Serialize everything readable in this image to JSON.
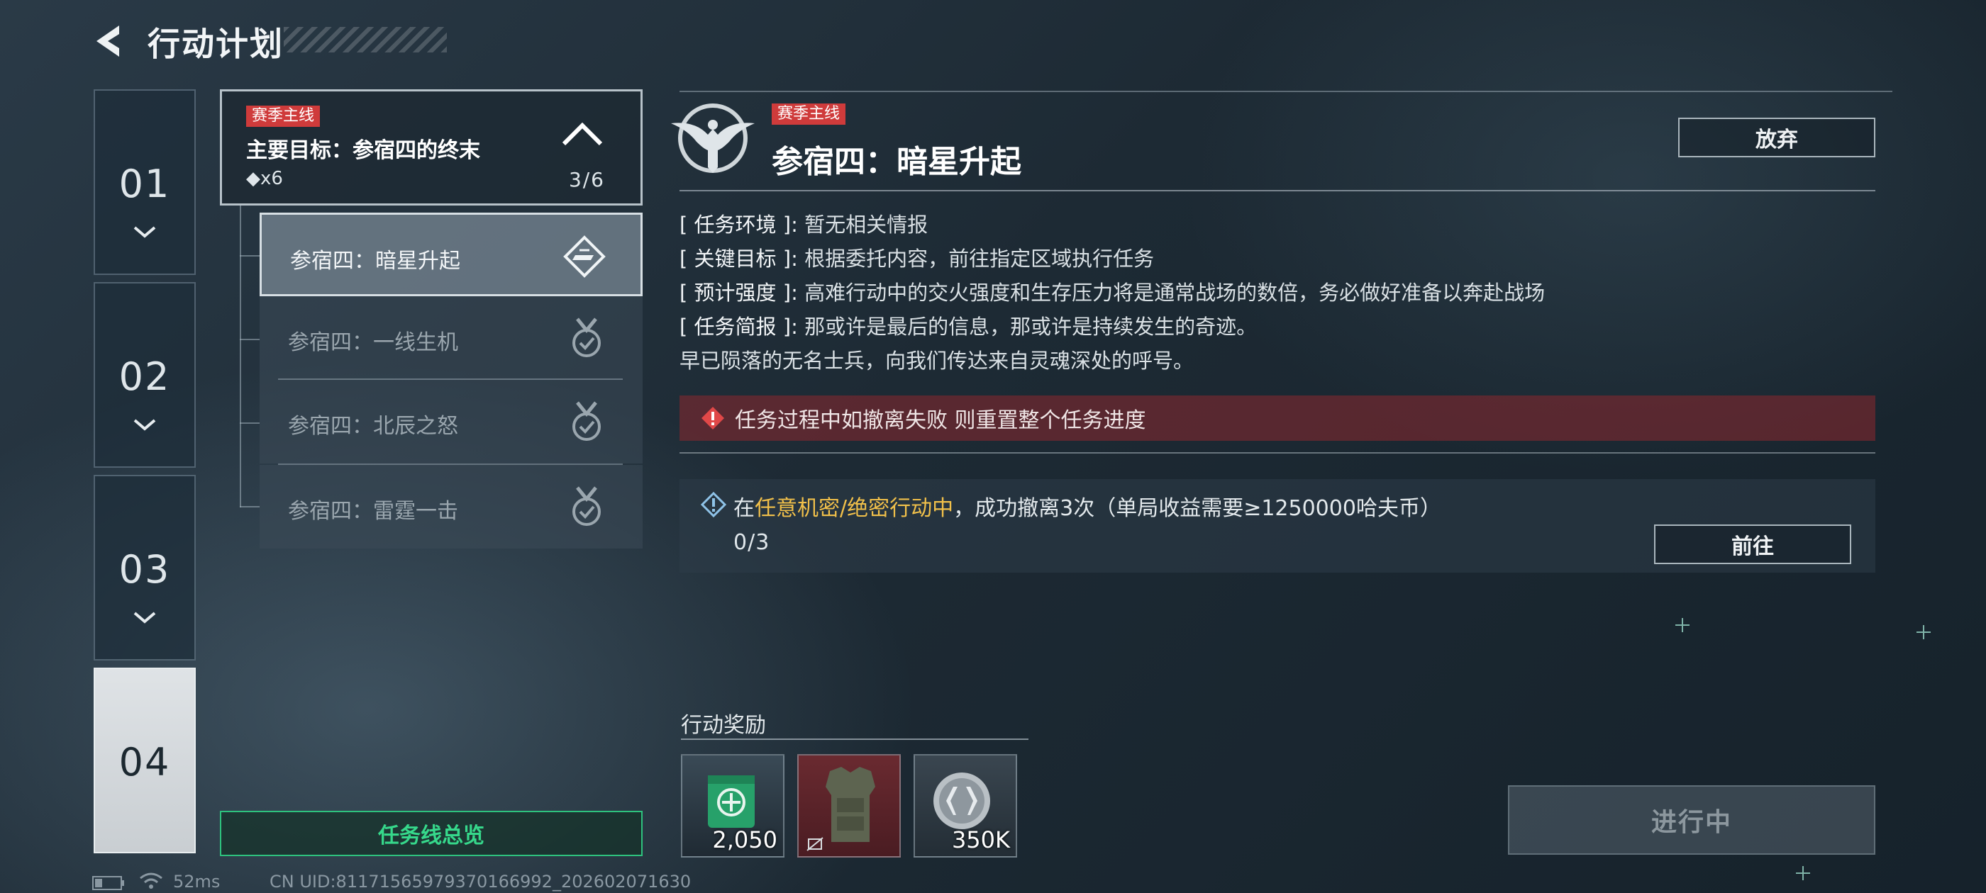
{
  "header": {
    "title": "行动计划"
  },
  "seasons": [
    {
      "label": "01"
    },
    {
      "label": "02"
    },
    {
      "label": "03"
    },
    {
      "label": "04"
    }
  ],
  "mission_group": {
    "tag": "赛季主线",
    "title": "主要目标：参宿四的终末",
    "count": "◆x6",
    "progress": "3/6"
  },
  "sub_missions": [
    {
      "label": "参宿四：暗星升起"
    },
    {
      "label": "参宿四：一线生机"
    },
    {
      "label": "参宿四：北辰之怒"
    },
    {
      "label": "参宿四：雷霆一击"
    }
  ],
  "overview_button": "任务线总览",
  "detail": {
    "tag": "赛季主线",
    "title": "参宿四：暗星升起",
    "abandon_label": "放弃",
    "info": [
      {
        "key": "任务环境",
        "value": "暂无相关情报"
      },
      {
        "key": "关键目标",
        "value": "根据委托内容，前往指定区域执行任务"
      },
      {
        "key": "预计强度",
        "value": "高难行动中的交火强度和生存压力将是通常战场的数倍，务必做好准备以奔赴战场"
      },
      {
        "key": "任务简报",
        "value": "那或许是最后的信息，那或许是持续发生的奇迹。"
      }
    ],
    "story": "早已陨落的无名士兵，向我们传达来自灵魂深处的呼号。",
    "warning": "任务过程中如撤离失败 则重置整个任务进度",
    "objective": {
      "prefix": "在",
      "highlight": "任意机密/绝密行动中",
      "suffix": "，成功撤离3次（单局收益需要≥1250000哈夫币）",
      "progress": "0/3",
      "goto_label": "前往"
    }
  },
  "rewards": {
    "label": "行动奖励",
    "items": [
      {
        "icon": "crate-icon",
        "qty": "2,050"
      },
      {
        "icon": "body-armor-icon",
        "qty": ""
      },
      {
        "icon": "coin-icon",
        "qty": "350K"
      }
    ]
  },
  "status_button": "进行中",
  "footer": {
    "ping": "52ms",
    "uid": "CN UID:81171565979370166992_202602071630"
  },
  "colors": {
    "tag_red": "#cf3b3b",
    "highlight_yellow": "#f1c04a",
    "overview_green": "#36d88b",
    "warning_bg": "#82282e"
  }
}
